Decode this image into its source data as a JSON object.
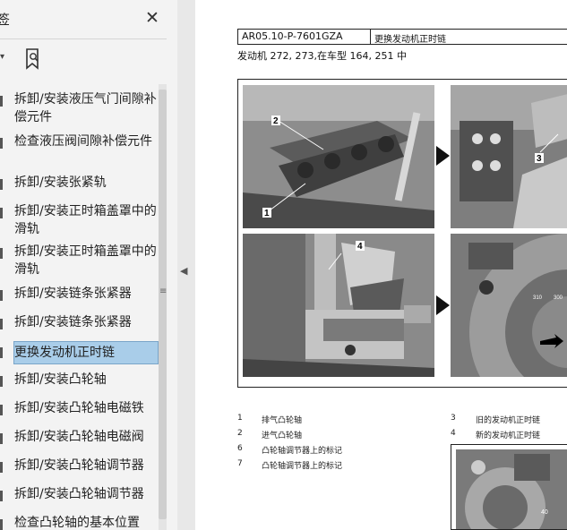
{
  "sidebar": {
    "title": "签",
    "close_glyph": "✕",
    "dropdown_glyph": "▾",
    "items": [
      {
        "label": "拆卸/安装液压气门间隙补偿元件",
        "active": false
      },
      {
        "label": "检查液压阀间隙补偿元件",
        "active": false
      },
      {
        "label": "拆卸/安装张紧轨",
        "active": false
      },
      {
        "label": "拆卸/安装正时箱盖罩中的滑轨",
        "active": false
      },
      {
        "label": "拆卸/安装正时箱盖罩中的滑轨",
        "active": false
      },
      {
        "label": "拆卸/安装链条张紧器",
        "active": false
      },
      {
        "label": "拆卸/安装链条张紧器",
        "active": false
      },
      {
        "label": "更换发动机正时链",
        "active": true
      },
      {
        "label": "拆卸/安装凸轮轴",
        "active": false
      },
      {
        "label": "拆卸/安装凸轮轴电磁铁",
        "active": false
      },
      {
        "label": "拆卸/安装凸轮轴电磁阀",
        "active": false
      },
      {
        "label": "拆卸/安装凸轮轴调节器",
        "active": false
      },
      {
        "label": "拆卸/安装凸轮轴调节器",
        "active": false
      },
      {
        "label": "检查凸轮轴的基本位置",
        "active": false
      }
    ],
    "grip_glyph": "≡",
    "collapse_glyph": "◀"
  },
  "document": {
    "code": "AR05.10-P-7601GZA",
    "title": "更换发动机正时链",
    "engine_line": "发动机    272, 273,在车型 164, 251 中",
    "figure_callouts": {
      "c1": "1",
      "c2": "2",
      "c3": "3",
      "c4": "4",
      "scale_310": "310",
      "scale_300": "300",
      "scale_40": "40"
    },
    "legend": [
      {
        "num": "1",
        "text": "排气凸轮轴"
      },
      {
        "num": "2",
        "text": "进气凸轮轴"
      },
      {
        "num": "6",
        "text": "凸轮轴调节器上的标记"
      },
      {
        "num": "7",
        "text": "凸轮轴调节器上的标记"
      },
      {
        "num": "3",
        "text": "旧的发动机正时链"
      },
      {
        "num": "4",
        "text": "新的发动机正时链"
      }
    ]
  }
}
